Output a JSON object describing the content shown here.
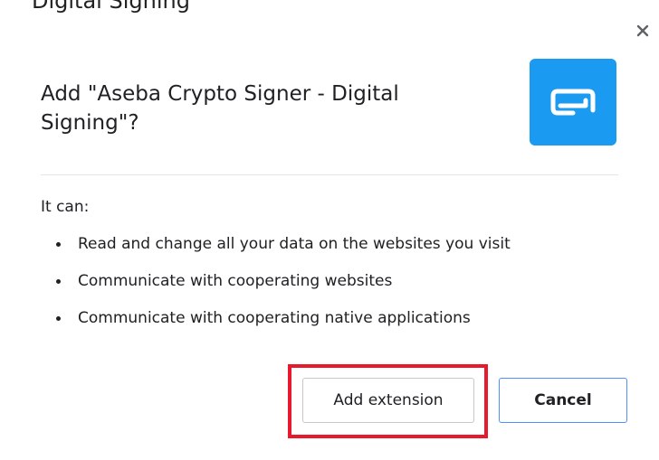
{
  "background_fragment": "Digital Signing",
  "dialog": {
    "title": "Add \"Aseba Crypto Signer - Digital Signing\"?",
    "close_icon": "close-icon",
    "extension_icon": "aseba-logo-icon",
    "accent_color": "#1a9af0",
    "it_can_label": "It can:",
    "permissions": [
      "Read and change all your data on the websites you visit",
      "Communicate with cooperating websites",
      "Communicate with cooperating native applications"
    ],
    "buttons": {
      "add_label": "Add extension",
      "cancel_label": "Cancel"
    },
    "highlight_color": "#e8192c"
  }
}
